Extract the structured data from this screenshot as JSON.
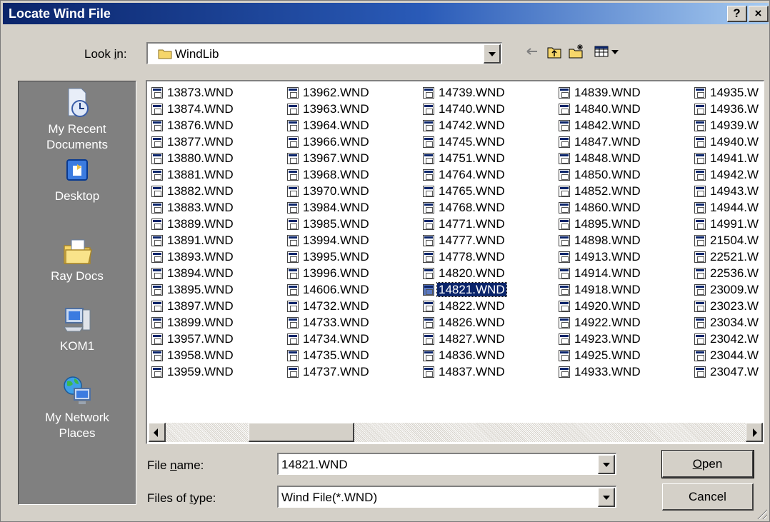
{
  "window": {
    "title": "Locate Wind File",
    "help_button": "?",
    "close_button": "×"
  },
  "look_in": {
    "label_prefix": "Look ",
    "label_accel": "i",
    "label_suffix": "n:",
    "value": "WindLib"
  },
  "toolbar": {
    "icons": [
      "back-icon",
      "up-folder-icon",
      "new-folder-icon",
      "view-menu-icon"
    ]
  },
  "places": [
    {
      "label_lines": [
        "My Recent",
        "Documents"
      ],
      "icon": "recent-documents-icon"
    },
    {
      "label_lines": [
        "Desktop"
      ],
      "icon": "desktop-icon"
    },
    {
      "label_lines": [
        "Ray Docs"
      ],
      "icon": "my-documents-icon"
    },
    {
      "label_lines": [
        "KOM1"
      ],
      "icon": "my-computer-icon"
    },
    {
      "label_lines": [
        "My Network",
        "Places"
      ],
      "icon": "network-places-icon"
    }
  ],
  "files": {
    "columns": [
      [
        "13873.WND",
        "13874.WND",
        "13876.WND",
        "13877.WND",
        "13880.WND",
        "13881.WND",
        "13882.WND",
        "13883.WND",
        "13889.WND",
        "13891.WND",
        "13893.WND",
        "13894.WND",
        "13895.WND",
        "13897.WND",
        "13899.WND",
        "13957.WND",
        "13958.WND",
        "13959.WND"
      ],
      [
        "13962.WND",
        "13963.WND",
        "13964.WND",
        "13966.WND",
        "13967.WND",
        "13968.WND",
        "13970.WND",
        "13984.WND",
        "13985.WND",
        "13994.WND",
        "13995.WND",
        "13996.WND",
        "14606.WND",
        "14732.WND",
        "14733.WND",
        "14734.WND",
        "14735.WND",
        "14737.WND"
      ],
      [
        "14739.WND",
        "14740.WND",
        "14742.WND",
        "14745.WND",
        "14751.WND",
        "14764.WND",
        "14765.WND",
        "14768.WND",
        "14771.WND",
        "14777.WND",
        "14778.WND",
        "14820.WND",
        "14821.WND",
        "14822.WND",
        "14826.WND",
        "14827.WND",
        "14836.WND",
        "14837.WND"
      ],
      [
        "14839.WND",
        "14840.WND",
        "14842.WND",
        "14847.WND",
        "14848.WND",
        "14850.WND",
        "14852.WND",
        "14860.WND",
        "14895.WND",
        "14898.WND",
        "14913.WND",
        "14914.WND",
        "14918.WND",
        "14920.WND",
        "14922.WND",
        "14923.WND",
        "14925.WND",
        "14933.WND"
      ],
      [
        "14935.W",
        "14936.W",
        "14939.W",
        "14940.W",
        "14941.W",
        "14942.W",
        "14943.W",
        "14944.W",
        "14991.W",
        "21504.W",
        "22521.W",
        "22536.W",
        "23009.W",
        "23023.W",
        "23034.W",
        "23042.W",
        "23044.W",
        "23047.W"
      ]
    ],
    "selected": "14821.WND"
  },
  "file_name": {
    "label_prefix": "File ",
    "label_accel": "n",
    "label_suffix": "ame:",
    "value": "14821.WND"
  },
  "file_type": {
    "label_prefix": "Files of ",
    "label_accel": "t",
    "label_suffix": "ype:",
    "value": "Wind File(*.WND)"
  },
  "buttons": {
    "open_accel": "O",
    "open_rest": "pen",
    "cancel": "Cancel"
  }
}
